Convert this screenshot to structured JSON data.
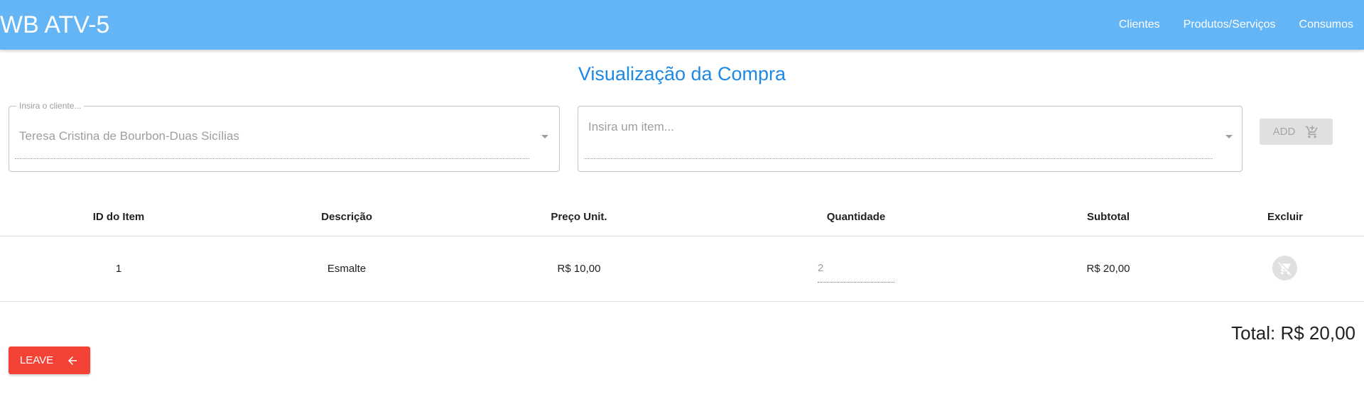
{
  "header": {
    "title": "WB ATV-5",
    "nav": [
      "Clientes",
      "Produtos/Serviços",
      "Consumos"
    ],
    "background": "#64b5f6"
  },
  "page": {
    "title": "Visualização da Compra"
  },
  "client_select": {
    "label": "Insira o cliente...",
    "value": "Teresa Cristina de Bourbon-Duas Sicílias"
  },
  "item_select": {
    "placeholder": "Insira um item..."
  },
  "add_button": {
    "label": "ADD",
    "icon": "add-shopping-cart-icon"
  },
  "table": {
    "headers": [
      "ID do Item",
      "Descrição",
      "Preço Unit.",
      "Quantidade",
      "Subtotal",
      "Excluir"
    ],
    "rows": [
      {
        "id": "1",
        "descricao": "Esmalte",
        "preco": "R$ 10,00",
        "quantidade": "2",
        "subtotal": "R$ 20,00",
        "delete_icon": "remove-shopping-cart-icon"
      }
    ]
  },
  "total": "Total: R$ 20,00",
  "leave_button": {
    "label": "LEAVE",
    "icon": "arrow-back-icon",
    "color": "#f44336"
  },
  "accent_color": "#1e88e5"
}
